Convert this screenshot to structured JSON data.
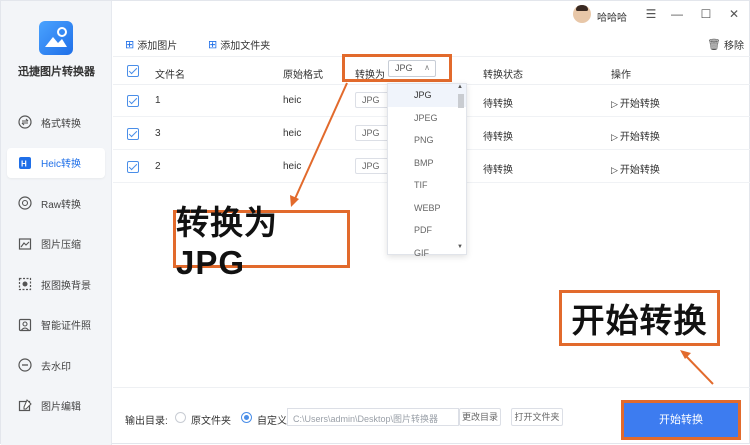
{
  "app": {
    "title": "迅捷图片转换器",
    "brand_color": "#1f6fe8",
    "annotation_color": "#e26a2c"
  },
  "sidebar": {
    "items": [
      {
        "label": "格式转换",
        "icon": "swap-icon"
      },
      {
        "label": "Heic转换",
        "icon": "heic-icon",
        "active": true
      },
      {
        "label": "Raw转换",
        "icon": "raw-icon"
      },
      {
        "label": "图片压缩",
        "icon": "compress-icon"
      },
      {
        "label": "抠图换背景",
        "icon": "cutout-icon"
      },
      {
        "label": "智能证件照",
        "icon": "id-photo-icon"
      },
      {
        "label": "去水印",
        "icon": "watermark-remove-icon"
      },
      {
        "label": "图片编辑",
        "icon": "image-edit-icon"
      }
    ]
  },
  "titlebar": {
    "username": "哈哈哈",
    "menu": "☰",
    "minimize": "—",
    "maximize": "☐",
    "close": "✕"
  },
  "toolbar": {
    "add_image": "添加图片",
    "add_folder": "添加文件夹",
    "remove": "移除"
  },
  "table": {
    "headers": {
      "filename": "文件名",
      "format": "原始格式",
      "convert_to": "转换为",
      "status": "转换状态",
      "action": "操作"
    },
    "header_select": "JPG",
    "rows": [
      {
        "name": "1",
        "format": "heic",
        "target": "JPG",
        "status": "待转换",
        "action": "开始转换"
      },
      {
        "name": "3",
        "format": "heic",
        "target": "JPG",
        "status": "待转换",
        "action": "开始转换"
      },
      {
        "name": "2",
        "format": "heic",
        "target": "JPG",
        "status": "待转换",
        "action": "开始转换"
      }
    ]
  },
  "dropdown": {
    "options": [
      "JPG",
      "JPEG",
      "PNG",
      "BMP",
      "TIF",
      "WEBP",
      "PDF",
      "GIF"
    ],
    "selected": "JPG"
  },
  "callouts": {
    "convert_to_jpg": "转换为JPG",
    "start_convert": "开始转换"
  },
  "bottom": {
    "output_label": "输出目录:",
    "original_folder": "原文件夹",
    "custom": "自定义",
    "path": "C:\\Users\\admin\\Desktop\\图片转换器",
    "change_dir": "更改目录",
    "open_folder": "打开文件夹",
    "start_button": "开始转换"
  }
}
